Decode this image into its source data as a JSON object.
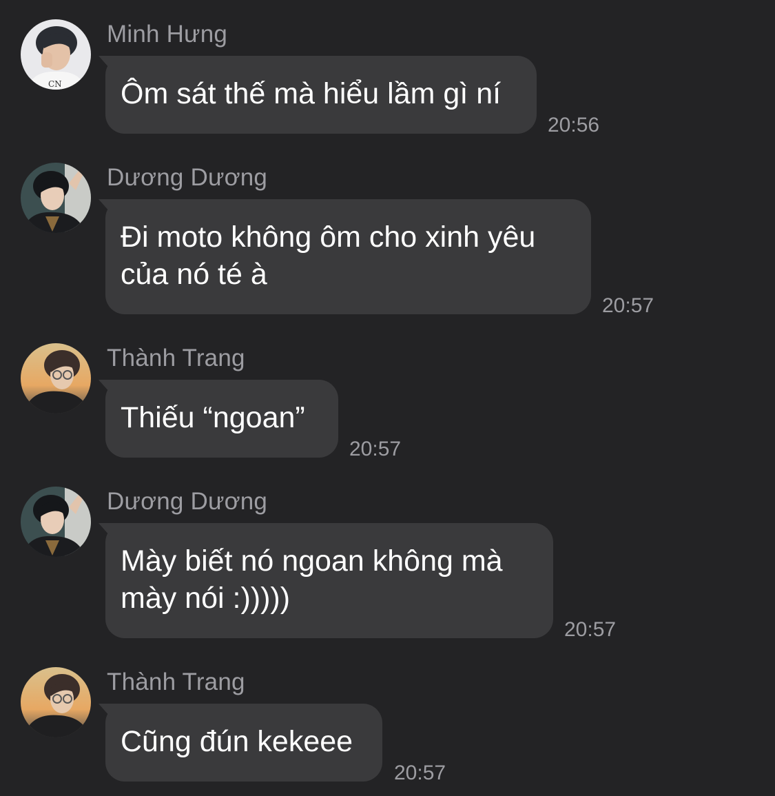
{
  "messages": [
    {
      "sender": "Minh Hưng",
      "text": "Ôm sát thế mà hiểu lầm gì ní",
      "time": "20:56",
      "avatar": "avatar-minh-hung"
    },
    {
      "sender": "Dương Dương",
      "text": "Đi moto không ôm cho xinh yêu\ncủa nó té à",
      "time": "20:57",
      "avatar": "avatar-duong-duong"
    },
    {
      "sender": "Thành Trang",
      "text": "Thiếu “ngoan”",
      "time": "20:57",
      "avatar": "avatar-thanh-trang"
    },
    {
      "sender": "Dương Dương",
      "text": "Mày biết nó ngoan không mà\nmày nói :)))))",
      "time": "20:57",
      "avatar": "avatar-duong-duong"
    },
    {
      "sender": "Thành Trang",
      "text": "Cũng đún kekeee",
      "time": "20:57",
      "avatar": "avatar-thanh-trang"
    }
  ],
  "colors": {
    "background": "#232325",
    "bubble": "#3a3a3c",
    "message_text": "#ffffff",
    "meta_text": "#9d9da2"
  }
}
